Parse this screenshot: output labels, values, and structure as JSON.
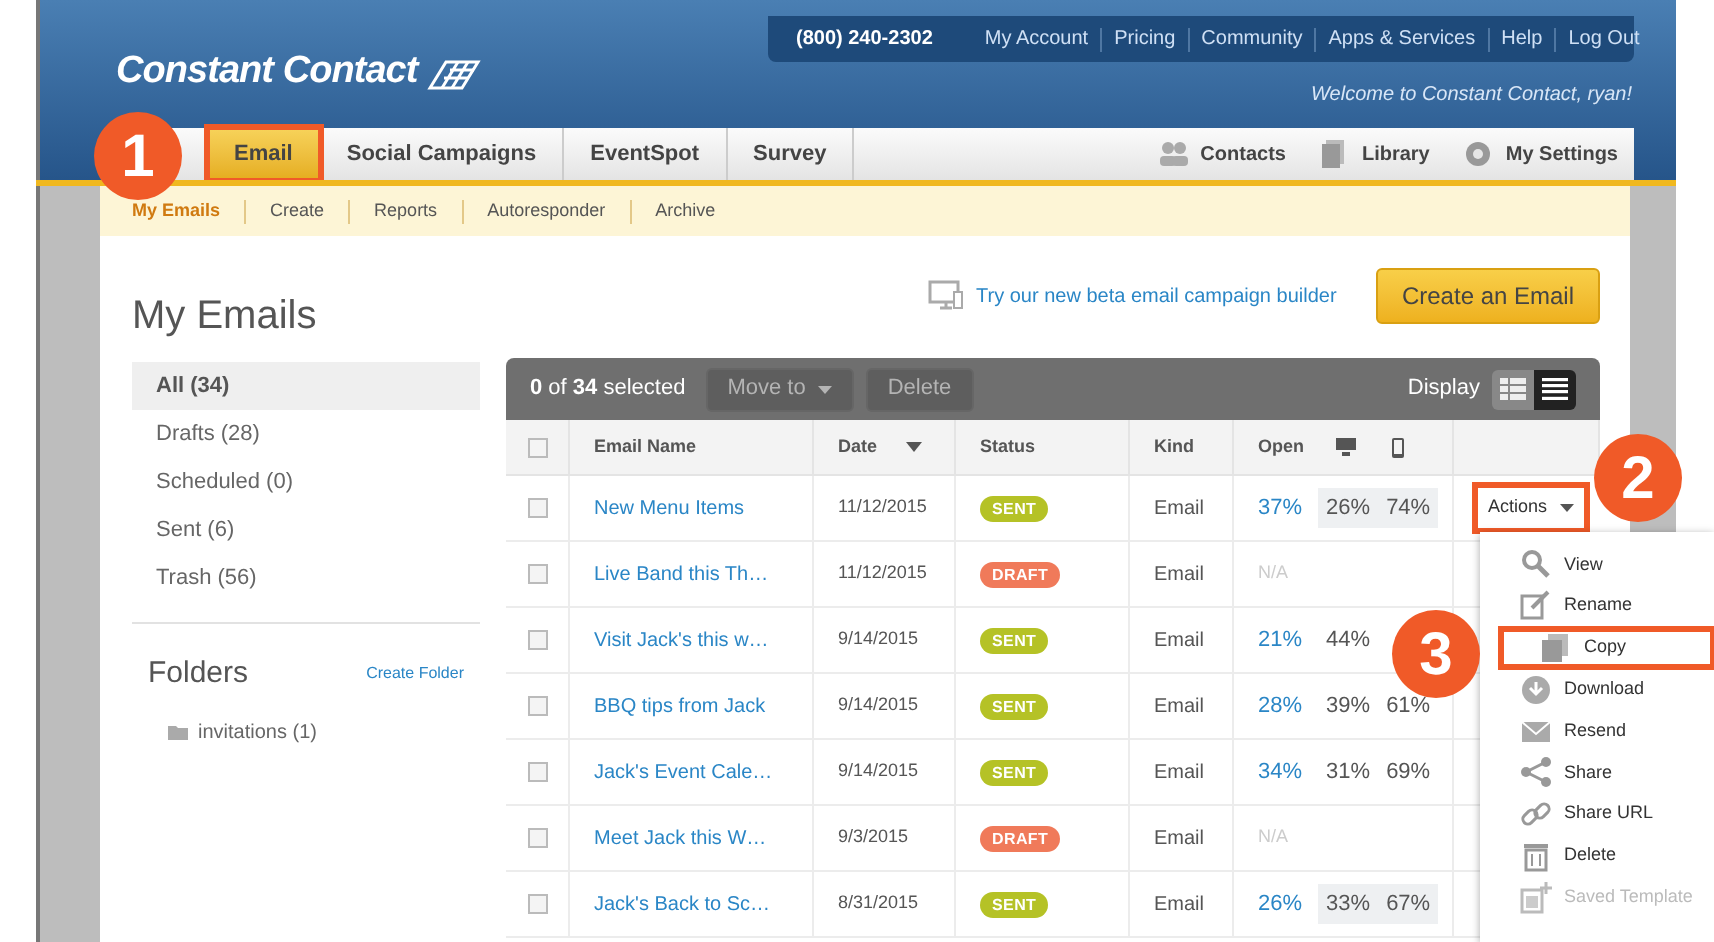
{
  "header": {
    "logo": "Constant Contact",
    "phone": "(800) 240-2302",
    "links": [
      "My Account",
      "Pricing",
      "Community",
      "Apps & Services",
      "Help",
      "Log Out"
    ],
    "welcome": "Welcome to Constant Contact, ryan!"
  },
  "tabs": [
    {
      "label": "Email",
      "selected": true,
      "highlighted": true
    },
    {
      "label": "Social Campaigns",
      "selected": false,
      "highlighted": false
    },
    {
      "label": "EventSpot",
      "selected": false,
      "highlighted": false
    },
    {
      "label": "Survey",
      "selected": false,
      "highlighted": false
    }
  ],
  "utility_links": [
    {
      "label": "Contacts",
      "kind": "contacts"
    },
    {
      "label": "Library",
      "kind": "library"
    },
    {
      "label": "My Settings",
      "kind": "settings"
    }
  ],
  "subnav": [
    {
      "label": "My Emails",
      "selected": true
    },
    {
      "label": "Create",
      "selected": false
    },
    {
      "label": "Reports",
      "selected": false
    },
    {
      "label": "Autoresponder",
      "selected": false
    },
    {
      "label": "Archive",
      "selected": false
    }
  ],
  "page_title": "My Emails",
  "beta_link": "Try our new beta email campaign builder",
  "create_button": "Create an Email",
  "filters": [
    {
      "label": "All (34)",
      "selected": true
    },
    {
      "label": "Drafts (28)",
      "selected": false
    },
    {
      "label": "Scheduled (0)",
      "selected": false
    },
    {
      "label": "Sent (6)",
      "selected": false
    },
    {
      "label": "Trash (56)",
      "selected": false
    }
  ],
  "folders": {
    "title": "Folders",
    "create": "Create Folder",
    "items": [
      "invitations (1)"
    ]
  },
  "toolbar": {
    "selection": "**0** of **34** selected",
    "move_to": "Move to",
    "delete": "Delete",
    "actions_disabled": true,
    "display": "Display"
  },
  "table": {
    "select_all_checked": false,
    "columns": [
      "Email Name",
      "Date",
      "Status",
      "Kind",
      "Open"
    ],
    "rows": [
      {
        "checked": false,
        "name": "New Menu Items",
        "date": "11/12/2015",
        "status": "SENT",
        "color": "#b5c226",
        "kind": "Email",
        "open": "37%",
        "desktop": "26%",
        "mobile": "74%",
        "muted": false,
        "highlighted": true,
        "actions": {
          "label": "Actions",
          "highlighted": true
        }
      },
      {
        "checked": false,
        "name": "Live Band this Th…",
        "date": "11/12/2015",
        "status": "DRAFT",
        "color": "#f07a5a",
        "kind": "Email",
        "open": "N/A",
        "muted": true,
        "highlighted": false
      },
      {
        "checked": false,
        "name": "Visit Jack's this w…",
        "date": "9/14/2015",
        "status": "SENT",
        "color": "#b5c226",
        "kind": "Email",
        "open": "21%",
        "desktop": "44%",
        "muted": false,
        "highlighted": false
      },
      {
        "checked": false,
        "name": "BBQ tips from Jack",
        "date": "9/14/2015",
        "status": "SENT",
        "color": "#b5c226",
        "kind": "Email",
        "open": "28%",
        "desktop": "39%",
        "mobile": "61%",
        "muted": false,
        "highlighted": false
      },
      {
        "checked": false,
        "name": "Jack's Event Cale…",
        "date": "9/14/2015",
        "status": "SENT",
        "color": "#b5c226",
        "kind": "Email",
        "open": "34%",
        "desktop": "31%",
        "mobile": "69%",
        "muted": false,
        "highlighted": false
      },
      {
        "checked": false,
        "name": "Meet Jack this W…",
        "date": "9/3/2015",
        "status": "DRAFT",
        "color": "#f07a5a",
        "kind": "Email",
        "open": "N/A",
        "muted": true,
        "highlighted": false
      },
      {
        "checked": false,
        "name": "Jack's Back to Sc…",
        "date": "8/31/2015",
        "status": "SENT",
        "color": "#b5c226",
        "kind": "Email",
        "open": "26%",
        "desktop": "33%",
        "mobile": "67%",
        "muted": false,
        "highlighted": true
      }
    ]
  },
  "actions_menu": [
    {
      "label": "View",
      "kind": "search",
      "disabled": false,
      "highlighted": false
    },
    {
      "label": "Rename",
      "kind": "pencil",
      "disabled": false,
      "highlighted": false
    },
    {
      "label": "Copy",
      "kind": "copy",
      "disabled": false,
      "highlighted": true
    },
    {
      "label": "Download",
      "kind": "download",
      "disabled": false,
      "highlighted": false
    },
    {
      "label": "Resend",
      "kind": "envelope",
      "disabled": false,
      "highlighted": false
    },
    {
      "label": "Share",
      "kind": "share",
      "disabled": false,
      "highlighted": false
    },
    {
      "label": "Share URL",
      "kind": "link",
      "disabled": false,
      "highlighted": false
    },
    {
      "label": "Delete",
      "kind": "trash",
      "disabled": false,
      "highlighted": false
    },
    {
      "label": "Saved Template",
      "kind": "template",
      "disabled": true,
      "highlighted": false
    }
  ],
  "callouts": [
    {
      "label": "1"
    },
    {
      "label": "2"
    },
    {
      "label": "3"
    }
  ]
}
